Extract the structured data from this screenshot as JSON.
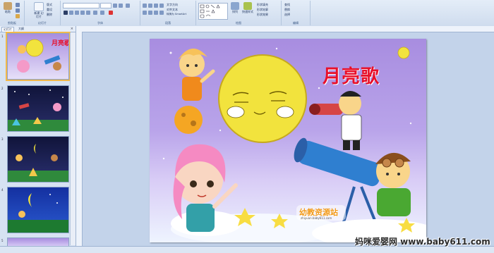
{
  "ribbon": {
    "groups": [
      {
        "label": "剪贴板",
        "buttons": [
          "粘贴"
        ]
      },
      {
        "label": "幻灯片",
        "buttons": [
          "新建\n幻灯片",
          "版式",
          "重设",
          "删除"
        ]
      },
      {
        "label": "字体"
      },
      {
        "label": "段落",
        "mini": [
          "文字方向",
          "对齐文本",
          "转换为 SmartArt"
        ]
      },
      {
        "label": "绘图",
        "buttons": [
          "排列",
          "快速样式"
        ],
        "mini": [
          "形状填充",
          "形状轮廓",
          "形状效果"
        ]
      },
      {
        "label": "编辑",
        "mini": [
          "查找",
          "替换",
          "选择"
        ]
      }
    ]
  },
  "pane": {
    "tabs": [
      "幻灯片",
      "大纲"
    ],
    "close": "×",
    "slide_numbers": [
      "1",
      "2",
      "3",
      "4",
      "5"
    ]
  },
  "slide": {
    "title": "月亮歌",
    "logo_text": "幼教资源站",
    "logo_url": "zhiyuan.baby611.com"
  },
  "watermark": "妈咪爱婴网  www.baby611.com",
  "colors": {
    "title": "#e8102a",
    "ribbon_bg": "#dbe6f4",
    "selection": "#f2b84b"
  }
}
